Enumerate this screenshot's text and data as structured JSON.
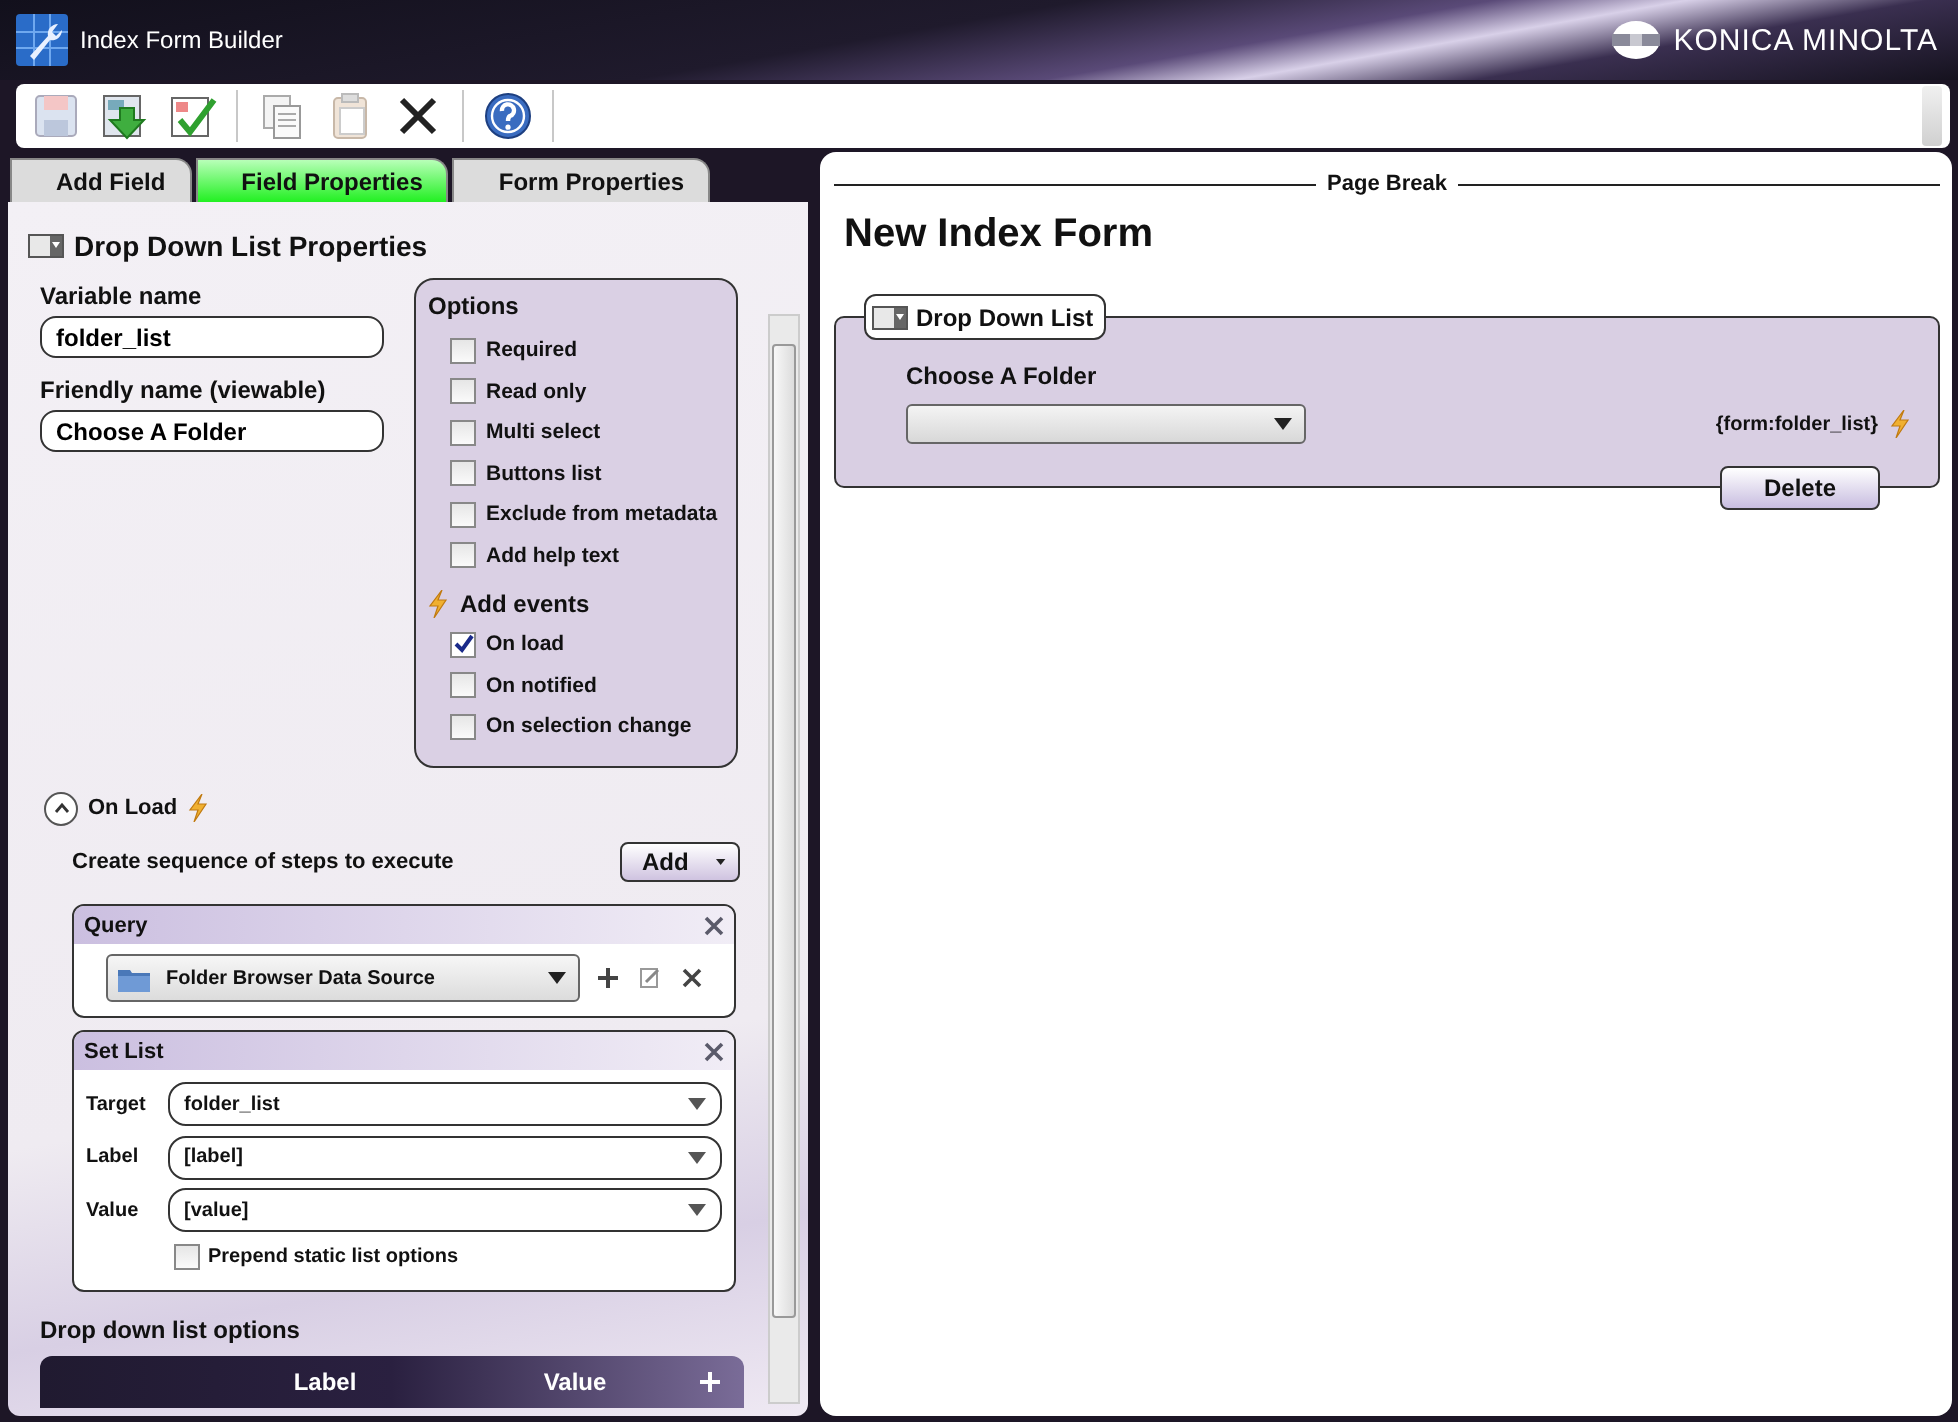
{
  "window": {
    "title": "Index Form Builder",
    "brand": "KONICA MINOLTA"
  },
  "tabs": [
    {
      "label": "Add Field",
      "selected": false
    },
    {
      "label": "Field Properties",
      "selected": true
    },
    {
      "label": "Form Properties",
      "selected": false
    }
  ],
  "properties": {
    "title": "Drop Down List Properties",
    "variable_label": "Variable name",
    "variable_value": "folder_list",
    "friendly_label": "Friendly name (viewable)",
    "friendly_value": "Choose A Folder",
    "options": {
      "title": "Options",
      "items": [
        {
          "label": "Required",
          "checked": false
        },
        {
          "label": "Read only",
          "checked": false
        },
        {
          "label": "Multi select",
          "checked": false
        },
        {
          "label": "Buttons list",
          "checked": false
        },
        {
          "label": "Exclude from metadata",
          "checked": false
        },
        {
          "label": "Add help text",
          "checked": false
        }
      ],
      "events_title": "Add events",
      "events": [
        {
          "label": "On load",
          "checked": true
        },
        {
          "label": "On notified",
          "checked": false
        },
        {
          "label": "On selection change",
          "checked": false
        }
      ]
    },
    "on_load": {
      "title": "On Load",
      "expanded": true,
      "instruction": "Create sequence of steps to execute",
      "add_button": "Add",
      "steps": [
        {
          "kind": "query",
          "title": "Query",
          "source": "Folder Browser Data Source"
        },
        {
          "kind": "set_list",
          "title": "Set List",
          "fields": [
            {
              "label": "Target",
              "value": "folder_list"
            },
            {
              "label": "Label",
              "value": "[label]"
            },
            {
              "label": "Value",
              "value": "[value]"
            }
          ],
          "prepend": {
            "label": "Prepend static list options",
            "checked": false
          }
        }
      ]
    },
    "list_options": {
      "title": "Drop down list options",
      "columns": [
        "Label",
        "Value"
      ]
    }
  },
  "form": {
    "page_break": "Page Break",
    "title": "New Index Form",
    "field": {
      "type_label": "Drop Down List",
      "label": "Choose A Folder",
      "variable": "{form:folder_list}",
      "delete_button": "Delete"
    }
  }
}
